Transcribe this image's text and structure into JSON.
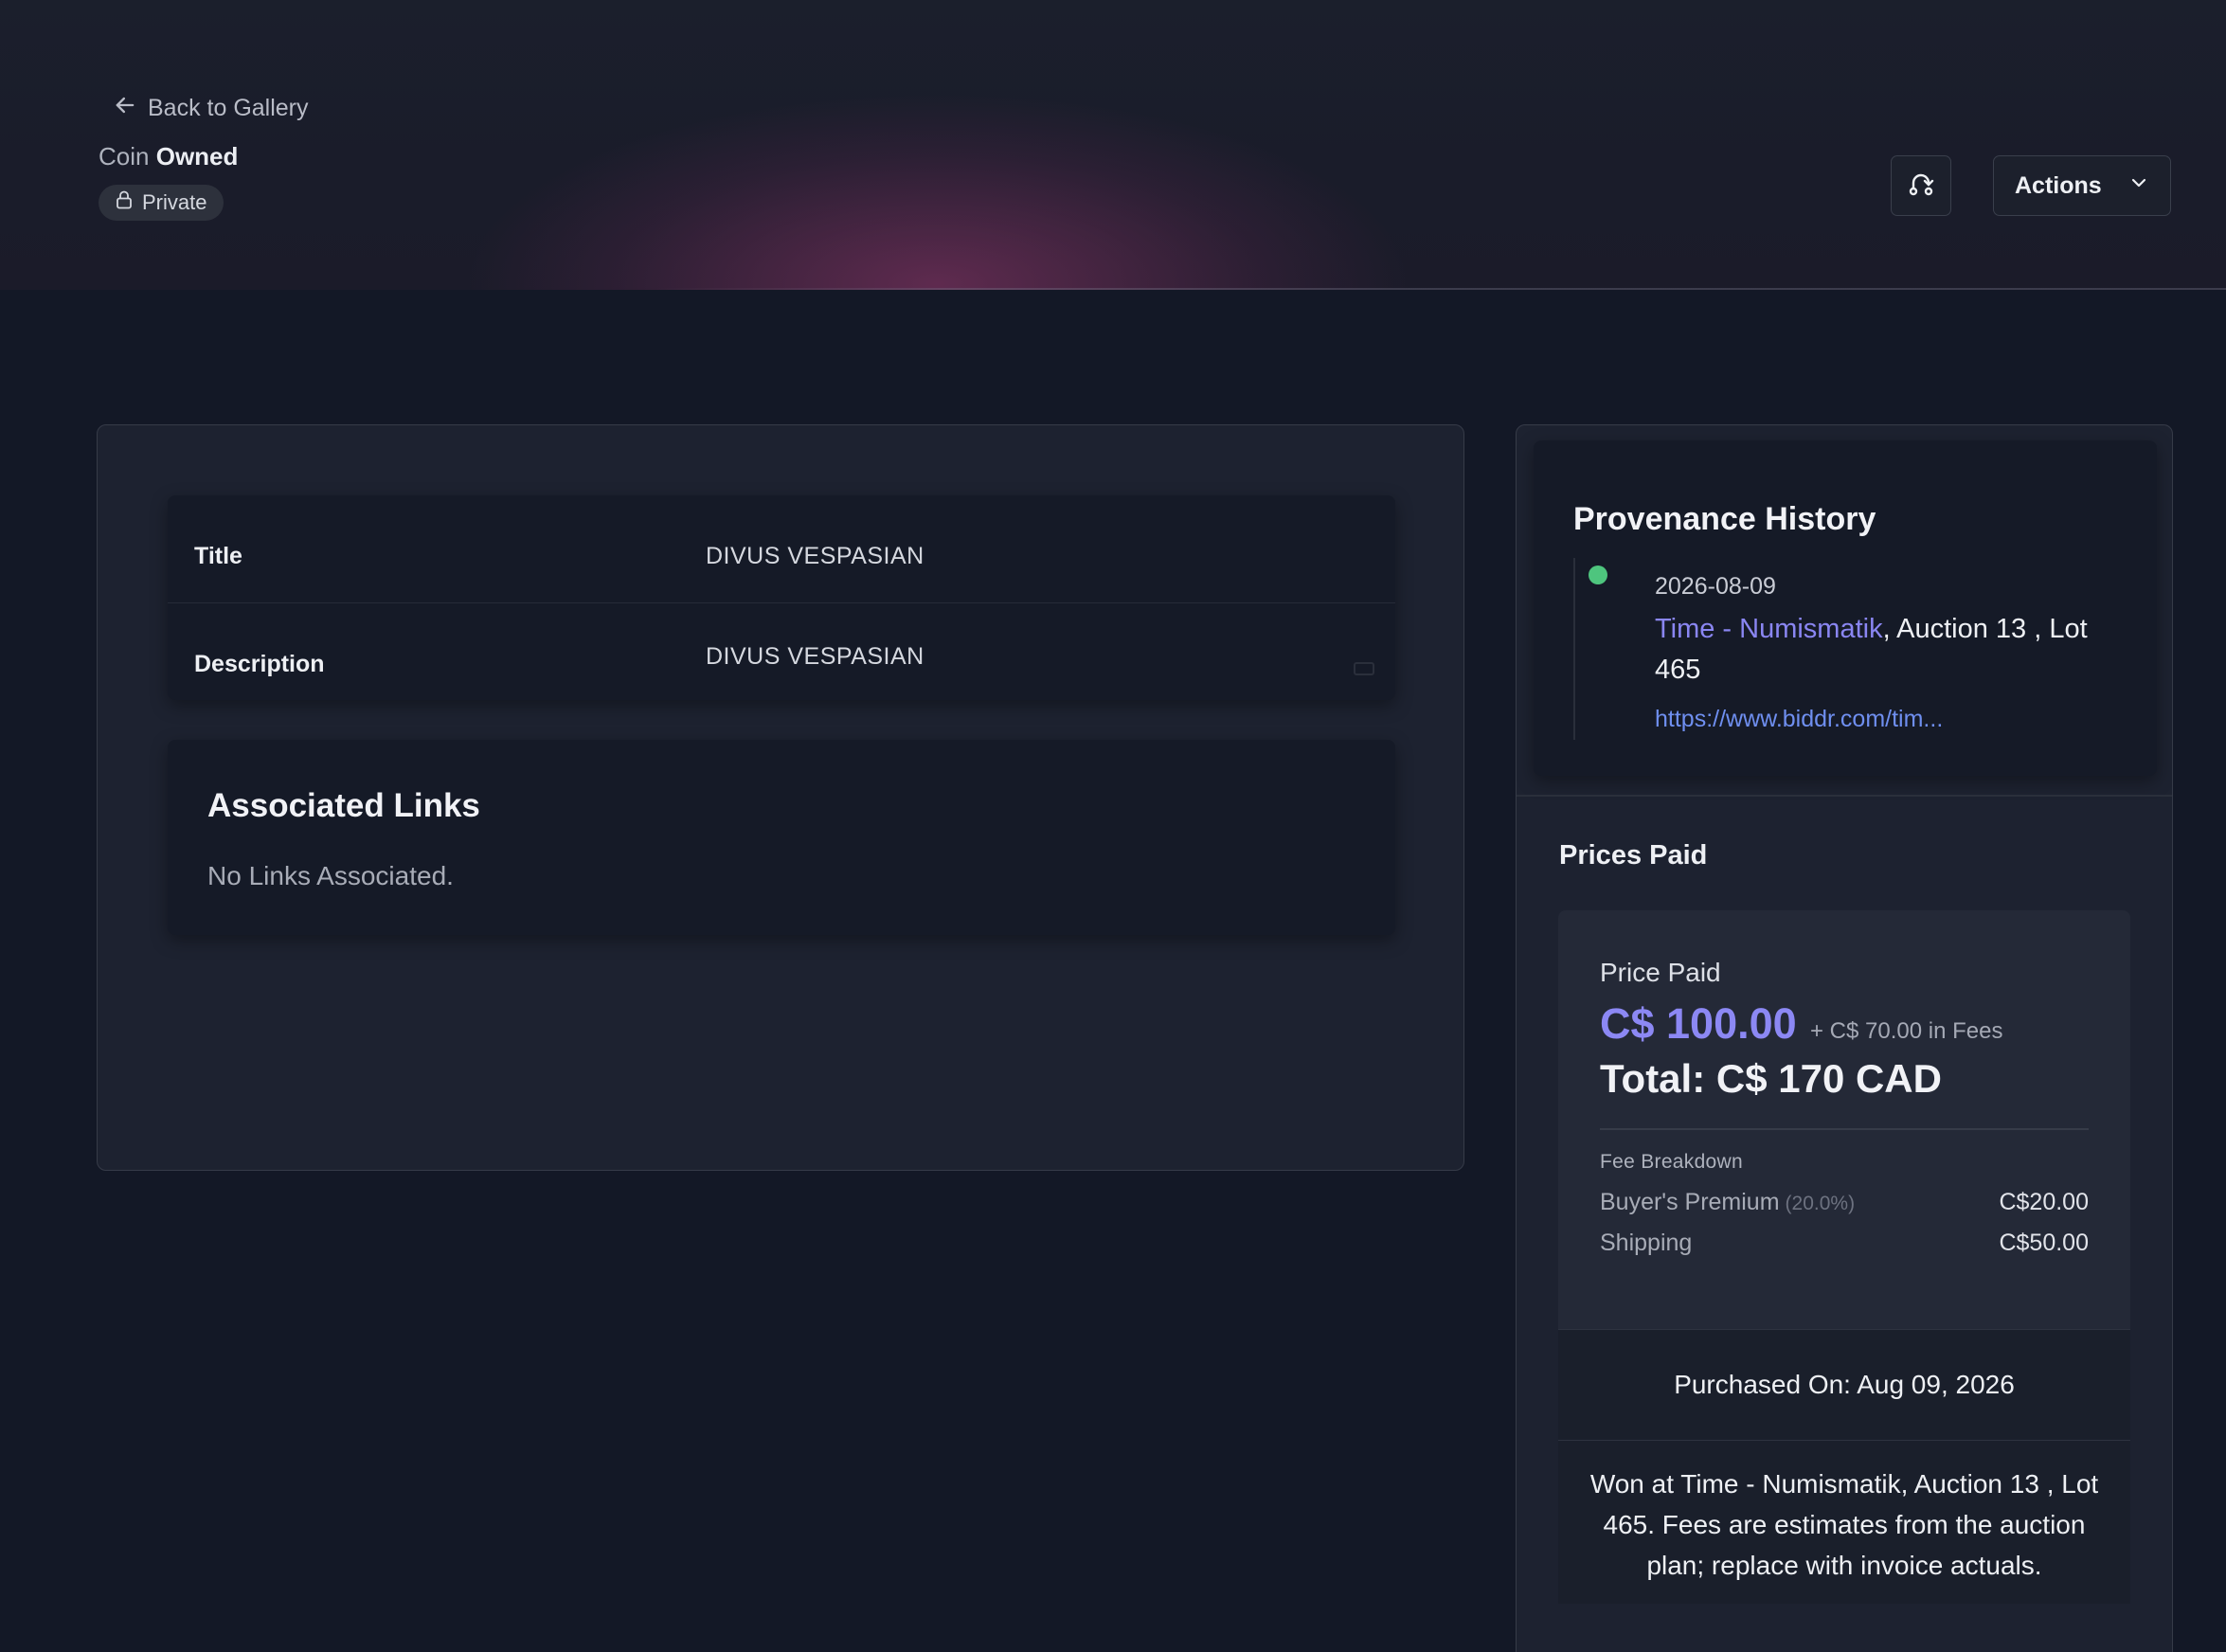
{
  "header": {
    "back_label": "Back to Gallery",
    "type_prefix": "Coin",
    "type_status": "Owned",
    "visibility_badge": "Private",
    "actions_label": "Actions"
  },
  "details": {
    "title_label": "Title",
    "title_value": "DIVUS VESPASIAN",
    "description_label": "Description",
    "description_value": "DIVUS VESPASIAN"
  },
  "links": {
    "heading": "Associated Links",
    "empty_text": "No Links Associated."
  },
  "provenance": {
    "heading": "Provenance History",
    "entries": [
      {
        "date": "2026-08-09",
        "auction_house": "Time - Numismatik",
        "detail": ", Auction 13 , Lot 465",
        "url": "https://www.biddr.com/tim..."
      }
    ],
    "status_color": "#4ec57e"
  },
  "prices": {
    "heading": "Prices Paid",
    "card": {
      "label": "Price Paid",
      "amount": "C$ 100.00",
      "fees_text": "+ C$ 70.00 in Fees",
      "total": "Total: C$ 170 CAD",
      "fee_breakdown_title": "Fee Breakdown",
      "fees": [
        {
          "name": "Buyer's Premium",
          "pct": "(20.0%)",
          "amount": "C$20.00"
        },
        {
          "name": "Shipping",
          "pct": "",
          "amount": "C$50.00"
        }
      ],
      "purchased_on": "Purchased On: Aug 09, 2026",
      "note": "Won at Time - Numismatik, Auction 13 , Lot 465. Fees are estimates from the auction plan; replace with invoice actuals."
    },
    "accent_color": "#8c88f4"
  },
  "icons": {
    "back": "arrow-left-icon",
    "lock": "lock-icon",
    "share": "share-icon",
    "chevron": "chevron-down-icon"
  }
}
